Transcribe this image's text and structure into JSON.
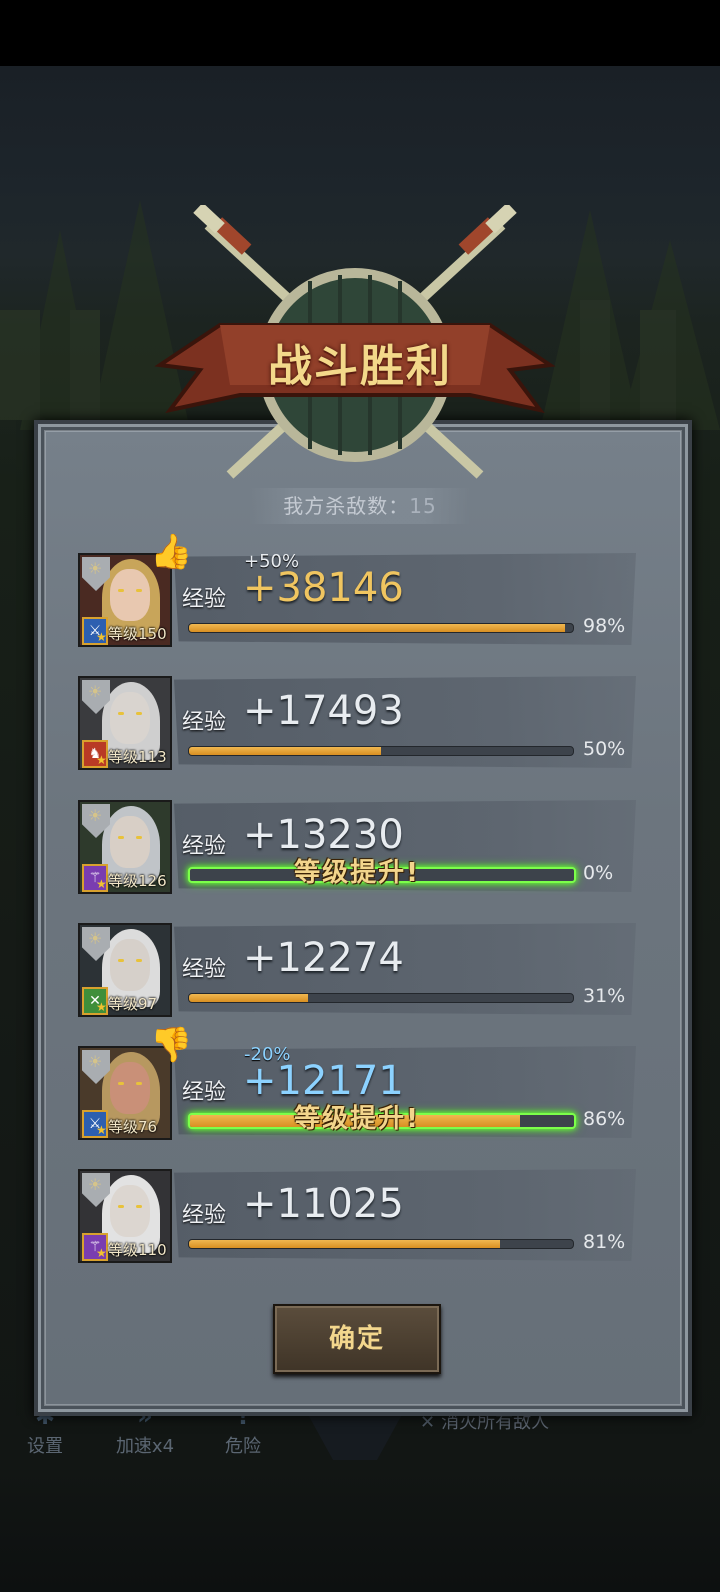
{
  "colors": {
    "accent_gold": "#f0c560",
    "accent_blue": "#8cd2ff",
    "level_up_glow": "#7cff4a",
    "bar_fill": "#e0a23a"
  },
  "banner": {
    "title": "战斗胜利"
  },
  "kills": {
    "label": "我方杀敌数：",
    "value": "15"
  },
  "exp_label": "经验",
  "level_up_text": "等级提升!",
  "heroes": [
    {
      "class_icon": "sword-class-icon",
      "level_text": "等级150",
      "bonus": "+50%",
      "bonus_icon": "thumbs-up-icon",
      "exp": "+38146",
      "progress": 0.98,
      "percent": "98%",
      "level_up": false
    },
    {
      "class_icon": "rooster-class-icon",
      "level_text": "等级113",
      "bonus": "",
      "bonus_icon": "",
      "exp": "+17493",
      "progress": 0.5,
      "percent": "50%",
      "level_up": false
    },
    {
      "class_icon": "staff-class-icon",
      "level_text": "等级126",
      "bonus": "",
      "bonus_icon": "",
      "exp": "+13230",
      "progress": 0.0,
      "percent": "0%",
      "level_up": true
    },
    {
      "class_icon": "crossed-swords-class-icon",
      "level_text": "等级97",
      "bonus": "",
      "bonus_icon": "",
      "exp": "+12274",
      "progress": 0.31,
      "percent": "31%",
      "level_up": false
    },
    {
      "class_icon": "sword-class-icon",
      "level_text": "等级76",
      "bonus": "-20%",
      "bonus_icon": "thumbs-down-icon",
      "exp": "+12171",
      "progress": 0.86,
      "percent": "86%",
      "level_up": true
    },
    {
      "class_icon": "staff-class-icon",
      "level_text": "等级110",
      "bonus": "",
      "bonus_icon": "",
      "exp": "+11025",
      "progress": 0.81,
      "percent": "81%",
      "level_up": false
    }
  ],
  "confirm_button": "确定",
  "hud": {
    "settings": "设置",
    "speed": "加速x4",
    "danger": "危险",
    "objective": "消灭所有敌人"
  }
}
